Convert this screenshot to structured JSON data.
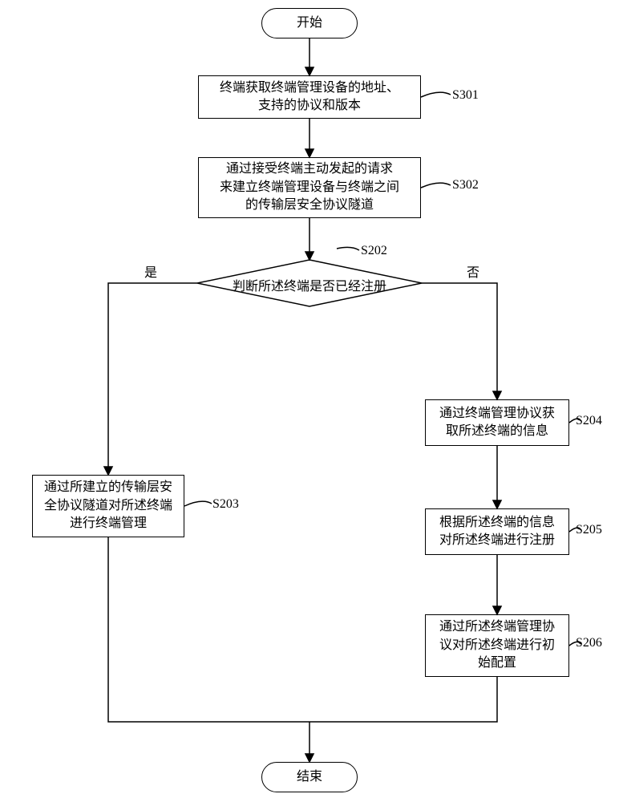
{
  "chart_data": {
    "type": "flowchart",
    "nodes": [
      {
        "id": "start",
        "type": "terminator",
        "text": "开始"
      },
      {
        "id": "s301",
        "type": "process",
        "text": "终端获取终端管理设备的地址、支持的协议和版本",
        "label": "S301"
      },
      {
        "id": "s302",
        "type": "process",
        "text": "通过接受终端主动发起的请求来建立终端管理设备与终端之间的传输层安全协议隧道",
        "label": "S302"
      },
      {
        "id": "s202",
        "type": "decision",
        "text": "判断所述终端是否已经注册",
        "label": "S202",
        "yes": "是",
        "no": "否"
      },
      {
        "id": "s203",
        "type": "process",
        "text": "通过所建立的传输层安全协议隧道对所述终端进行终端管理",
        "label": "S203"
      },
      {
        "id": "s204",
        "type": "process",
        "text": "通过终端管理协议获取所述终端的信息",
        "label": "S204"
      },
      {
        "id": "s205",
        "type": "process",
        "text": "根据所述终端的信息对所述终端进行注册",
        "label": "S205"
      },
      {
        "id": "s206",
        "type": "process",
        "text": "通过所述终端管理协议对所述终端进行初始配置",
        "label": "S206"
      },
      {
        "id": "end",
        "type": "terminator",
        "text": "结束"
      }
    ],
    "edges": [
      {
        "from": "start",
        "to": "s301"
      },
      {
        "from": "s301",
        "to": "s302"
      },
      {
        "from": "s302",
        "to": "s202"
      },
      {
        "from": "s202",
        "to": "s203",
        "label": "是"
      },
      {
        "from": "s202",
        "to": "s204",
        "label": "否"
      },
      {
        "from": "s204",
        "to": "s205"
      },
      {
        "from": "s205",
        "to": "s206"
      },
      {
        "from": "s203",
        "to": "end"
      },
      {
        "from": "s206",
        "to": "end"
      }
    ]
  },
  "labels": {
    "start": "开始",
    "end": "结束",
    "s301_text": "终端获取终端管理设备的地址、\n支持的协议和版本",
    "s301_label": "S301",
    "s302_text": "通过接受终端主动发起的请求\n来建立终端管理设备与终端之间\n的传输层安全协议隧道",
    "s302_label": "S302",
    "s202_text": "判断所述终端是否已经注册",
    "s202_label": "S202",
    "yes": "是",
    "no": "否",
    "s203_text": "通过所建立的传输层安\n全协议隧道对所述终端\n进行终端管理",
    "s203_label": "S203",
    "s204_text": "通过终端管理协议获\n取所述终端的信息",
    "s204_label": "S204",
    "s205_text": "根据所述终端的信息\n对所述终端进行注册",
    "s205_label": "S205",
    "s206_text": "通过所述终端管理协\n议对所述终端进行初\n始配置",
    "s206_label": "S206"
  }
}
